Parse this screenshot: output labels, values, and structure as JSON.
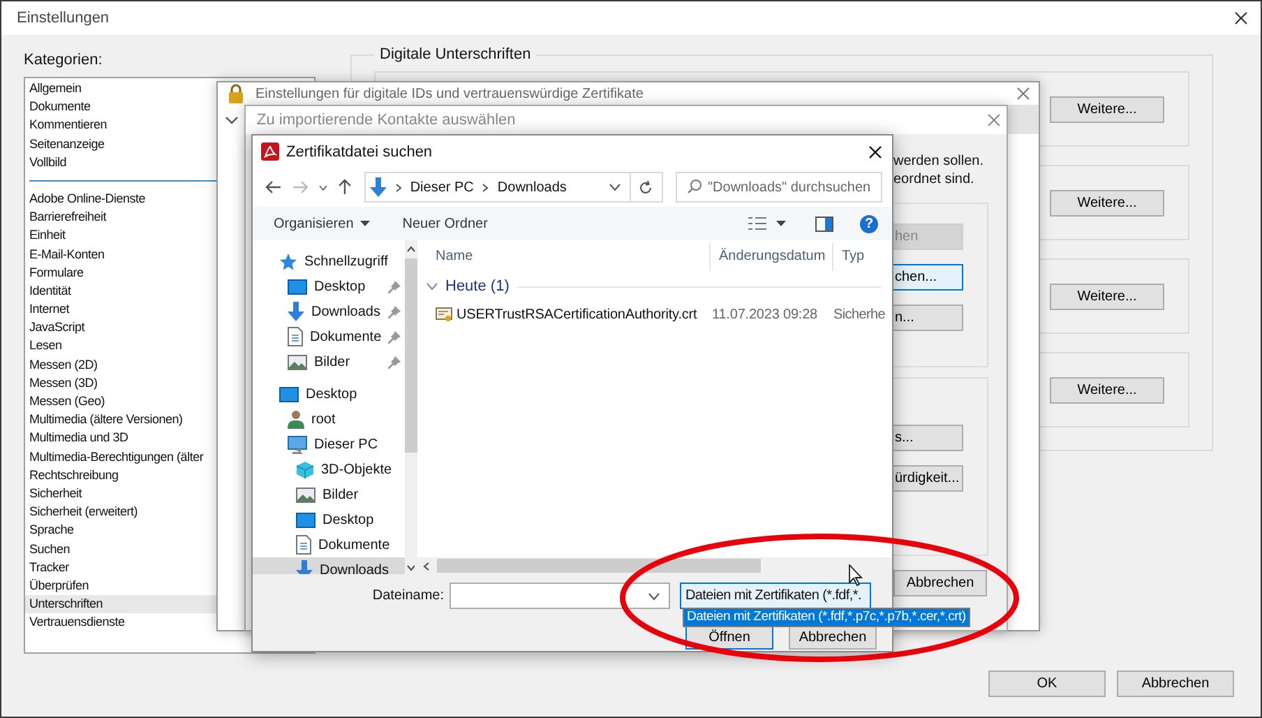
{
  "window": {
    "title": "Einstellungen"
  },
  "categories": {
    "label": "Kategorien:",
    "groups": [
      [
        {
          "label": "Allgemein",
          "selected": false
        },
        {
          "label": "Dokumente",
          "selected": false
        },
        {
          "label": "Kommentieren",
          "selected": false
        },
        {
          "label": "Seitenanzeige",
          "selected": false
        },
        {
          "label": "Vollbild",
          "selected": false
        }
      ],
      [
        {
          "label": "Adobe Online-Dienste",
          "selected": false
        },
        {
          "label": "Barrierefreiheit",
          "selected": false
        },
        {
          "label": "Einheit",
          "selected": false
        },
        {
          "label": "E-Mail-Konten",
          "selected": false
        },
        {
          "label": "Formulare",
          "selected": false
        },
        {
          "label": "Identität",
          "selected": false
        },
        {
          "label": "Internet",
          "selected": false
        },
        {
          "label": "JavaScript",
          "selected": false
        },
        {
          "label": "Lesen",
          "selected": false
        },
        {
          "label": "Messen (2D)",
          "selected": false
        },
        {
          "label": "Messen (3D)",
          "selected": false
        },
        {
          "label": "Messen (Geo)",
          "selected": false
        },
        {
          "label": "Multimedia (ältere Versionen)",
          "selected": false
        },
        {
          "label": "Multimedia und 3D",
          "selected": false
        },
        {
          "label": "Multimedia-Berechtigungen (älter",
          "selected": false
        },
        {
          "label": "Rechtschreibung",
          "selected": false
        },
        {
          "label": "Sicherheit",
          "selected": false
        },
        {
          "label": "Sicherheit (erweitert)",
          "selected": false
        },
        {
          "label": "Sprache",
          "selected": false
        },
        {
          "label": "Suchen",
          "selected": false
        },
        {
          "label": "Tracker",
          "selected": false
        },
        {
          "label": "Überprüfen",
          "selected": false
        },
        {
          "label": "Unterschriften",
          "selected": true
        },
        {
          "label": "Vertrauensdienste",
          "selected": false
        }
      ]
    ]
  },
  "signatures": {
    "title": "Digitale Unterschriften",
    "buttons": [
      "Weitere...",
      "Weitere...",
      "Weitere...",
      "Weitere..."
    ]
  },
  "footer_buttons": [
    "OK",
    "Abbrechen"
  ],
  "id_dialog": {
    "title": "Einstellungen für digitale IDs und vertrauenswürdige Zertifikate"
  },
  "contacts_dialog": {
    "title": "Zu importierende Kontakte auswählen",
    "text_lines": [
      "werden sollen.",
      "eordnet sind."
    ],
    "button_groups": [
      [
        {
          "label": "hen",
          "disabled": true,
          "focused": false
        },
        {
          "label": "chen...",
          "disabled": false,
          "focused": true
        },
        {
          "label": "n...",
          "disabled": false,
          "focused": false
        }
      ],
      [
        {
          "label": "s...",
          "disabled": false,
          "focused": false
        },
        {
          "label": "ürdigkeit...",
          "disabled": false,
          "focused": false
        }
      ]
    ],
    "cancel": "Abbrechen"
  },
  "file_dialog": {
    "title": "Zertifikatdatei suchen",
    "path": [
      "Dieser PC",
      "Downloads"
    ],
    "search": {
      "placeholder": "\"Downloads\" durchsuchen"
    },
    "toolbar": [
      "Organisieren",
      "Neuer Ordner"
    ],
    "help": "?",
    "nav": [
      {
        "label": "Schnellzugriff",
        "kind": "star",
        "selected": false,
        "children": [
          {
            "label": "Desktop",
            "kind": "desktop",
            "pinned": true,
            "selected": false
          },
          {
            "label": "Downloads",
            "kind": "download",
            "pinned": true,
            "selected": false
          },
          {
            "label": "Dokumente",
            "kind": "document",
            "pinned": true,
            "selected": false
          },
          {
            "label": "Bilder",
            "kind": "pictures",
            "pinned": true,
            "selected": false
          }
        ]
      },
      {
        "label": "Desktop",
        "kind": "desktop",
        "selected": false,
        "children": [
          {
            "label": "root",
            "kind": "user",
            "selected": false
          },
          {
            "label": "Dieser PC",
            "kind": "pc",
            "selected": false,
            "children": [
              {
                "label": "3D-Objekte",
                "kind": "cube",
                "selected": false
              },
              {
                "label": "Bilder",
                "kind": "pictures",
                "selected": false
              },
              {
                "label": "Desktop",
                "kind": "desktop",
                "selected": false
              },
              {
                "label": "Dokumente",
                "kind": "document",
                "selected": false
              },
              {
                "label": "Downloads",
                "kind": "download",
                "selected": true
              }
            ]
          }
        ]
      }
    ],
    "columns": [
      "Name",
      "Änderungsdatum",
      "Typ"
    ],
    "groups": [
      {
        "label": "Heute (1)",
        "expanded": true,
        "files": [
          {
            "name": "USERTrustRSACertificationAuthority.crt",
            "date": "11.07.2023 09:28",
            "type": "Sicherhe"
          }
        ]
      }
    ],
    "filename_label": "Dateiname:",
    "filter": {
      "value": "Dateien mit Zertifikaten (*.fdf,*.",
      "options": [
        {
          "label": "Dateien mit Zertifikaten (*.fdf,*.p7c,*.p7b,*.cer,*.crt)",
          "selected": true
        }
      ]
    },
    "buttons": [
      "Öffnen",
      "Abbrechen"
    ]
  }
}
